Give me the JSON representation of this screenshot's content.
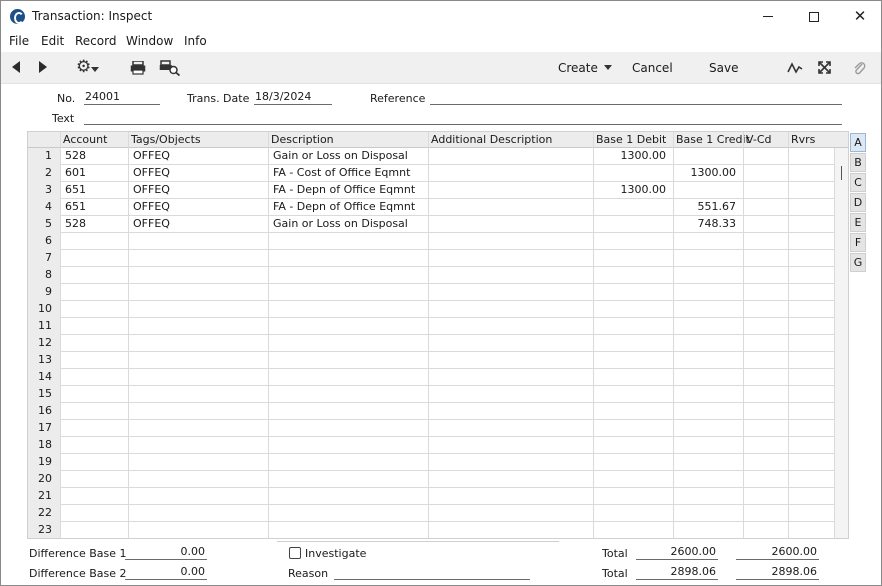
{
  "window": {
    "title": "Transaction: Inspect"
  },
  "menu": [
    "File",
    "Edit",
    "Record",
    "Window",
    "Info"
  ],
  "toolbar": {
    "create_label": "Create",
    "cancel_label": "Cancel",
    "save_label": "Save"
  },
  "header": {
    "no_label": "No.",
    "no_value": "24001",
    "date_label": "Trans. Date",
    "date_value": "18/3/2024",
    "reference_label": "Reference",
    "reference_value": "",
    "text_label": "Text",
    "text_value": ""
  },
  "grid": {
    "columns": [
      "Account",
      "Tags/Objects",
      "Description",
      "Additional Description",
      "Base 1 Debit",
      "Base 1 Credit",
      "V-Cd",
      "Rvrs"
    ],
    "rows": [
      {
        "n": "1",
        "account": "528",
        "tags": "OFFEQ",
        "description": "Gain or Loss on Disposal",
        "add_desc": "",
        "debit": "1300.00",
        "credit": "",
        "vcd": "",
        "rvrs": ""
      },
      {
        "n": "2",
        "account": "601",
        "tags": "OFFEQ",
        "description": "FA - Cost of Office Eqmnt",
        "add_desc": "",
        "debit": "",
        "credit": "1300.00",
        "vcd": "",
        "rvrs": ""
      },
      {
        "n": "3",
        "account": "651",
        "tags": "OFFEQ",
        "description": "FA - Depn of Office Eqmnt",
        "add_desc": "",
        "debit": "1300.00",
        "credit": "",
        "vcd": "",
        "rvrs": ""
      },
      {
        "n": "4",
        "account": "651",
        "tags": "OFFEQ",
        "description": "FA - Depn of Office Eqmnt",
        "add_desc": "",
        "debit": "",
        "credit": "551.67",
        "vcd": "",
        "rvrs": ""
      },
      {
        "n": "5",
        "account": "528",
        "tags": "OFFEQ",
        "description": "Gain or Loss on Disposal",
        "add_desc": "",
        "debit": "",
        "credit": "748.33",
        "vcd": "",
        "rvrs": ""
      },
      {
        "n": "6"
      },
      {
        "n": "7"
      },
      {
        "n": "8"
      },
      {
        "n": "9"
      },
      {
        "n": "10"
      },
      {
        "n": "11"
      },
      {
        "n": "12"
      },
      {
        "n": "13"
      },
      {
        "n": "14"
      },
      {
        "n": "15"
      },
      {
        "n": "16"
      },
      {
        "n": "17"
      },
      {
        "n": "18"
      },
      {
        "n": "19"
      },
      {
        "n": "20"
      },
      {
        "n": "21"
      },
      {
        "n": "22"
      },
      {
        "n": "23"
      }
    ]
  },
  "side_tabs": [
    "A",
    "B",
    "C",
    "D",
    "E",
    "F",
    "G"
  ],
  "footer": {
    "diff1_label": "Difference Base 1",
    "diff1_value": "0.00",
    "diff2_label": "Difference Base 2",
    "diff2_value": "0.00",
    "investigate_label": "Investigate",
    "reason_label": "Reason",
    "reason_value": "",
    "total1_label": "Total",
    "total1_debit": "2600.00",
    "total1_credit": "2600.00",
    "total2_label": "Total",
    "total2_debit": "2898.06",
    "total2_credit": "2898.06"
  }
}
